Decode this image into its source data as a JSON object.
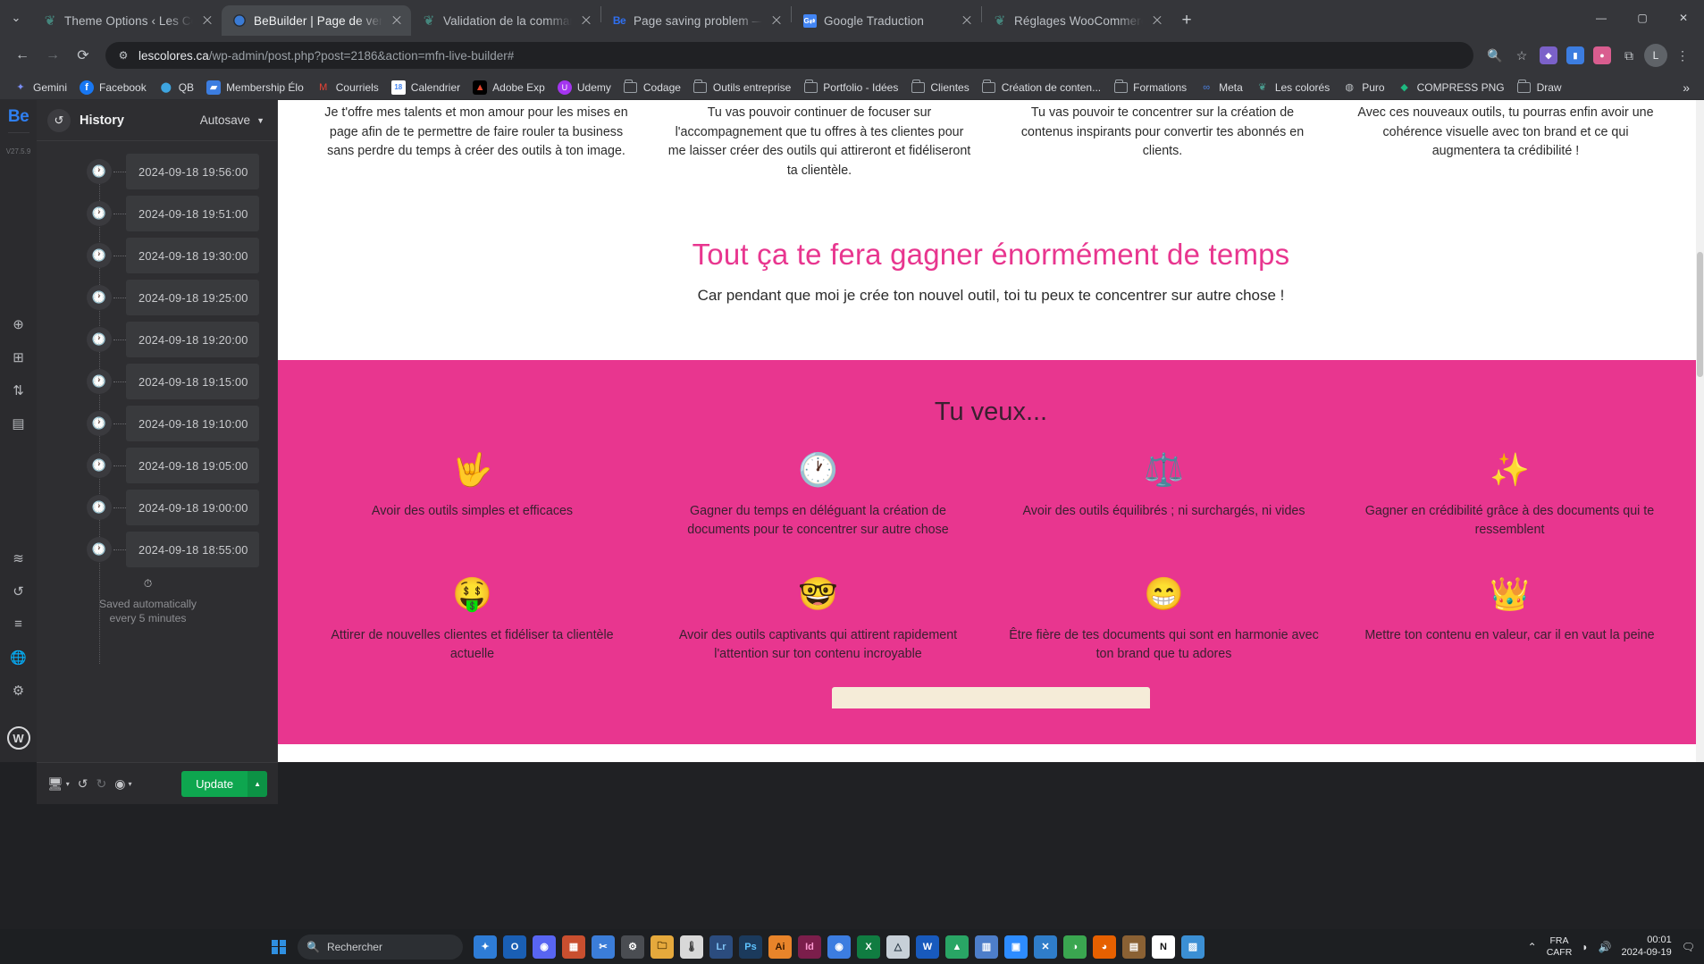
{
  "browser": {
    "tabs": [
      {
        "title": "Theme Options ‹ Les Colorés —",
        "favicon": "wordpress-icon",
        "active": false
      },
      {
        "title": "BeBuilder | Page de vente – Out",
        "favicon": "globe-icon",
        "active": true
      },
      {
        "title": "Validation de la commande - Le",
        "favicon": "wordpress-icon",
        "active": false
      },
      {
        "title": "Page saving problem — Bethem",
        "favicon": "bebuilder-icon",
        "active": false
      },
      {
        "title": "Google Traduction",
        "favicon": "google-translate-icon",
        "active": false
      },
      {
        "title": "Réglages WooCommerce ‹ Les C",
        "favicon": "wordpress-icon",
        "active": false
      }
    ],
    "new_tab_label": "+",
    "tab_search_label": "⌄",
    "window_controls": {
      "minimize": "—",
      "maximize": "▢",
      "close": "✕"
    },
    "nav": {
      "back": "←",
      "forward": "→",
      "reload": "⟳"
    },
    "url": {
      "host": "lescolores.ca",
      "path": "/wp-admin/post.php?post=2186&action=mfn-live-builder#",
      "site_info_icon": "page-info-icon"
    },
    "omnibox_actions": [
      {
        "name": "search-icon",
        "glyph": "🔍"
      },
      {
        "name": "bookmark-star-icon",
        "glyph": "☆"
      }
    ],
    "extensions": [
      {
        "name": "extension-puzzle-icon",
        "glyph": "🧩",
        "color": "#7b61c9"
      },
      {
        "name": "extension-bar-icon",
        "glyph": "▮▮",
        "color": "#3c7de0"
      },
      {
        "name": "extension-circle-icon",
        "glyph": "◕",
        "color": "#d95d8f"
      },
      {
        "name": "extensions-menu-icon",
        "glyph": "⧉",
        "color": "#5f6368"
      }
    ],
    "profile_initial": "L",
    "chrome_menu_icon": "⋮",
    "bookmarks": [
      {
        "label": "Gemini",
        "icon": "gemini-icon",
        "type": "site"
      },
      {
        "label": "Facebook",
        "icon": "facebook-icon",
        "type": "site"
      },
      {
        "label": "QB",
        "icon": "quickbooks-icon",
        "type": "site"
      },
      {
        "label": "Membership Élo",
        "icon": "membership-icon",
        "type": "site"
      },
      {
        "label": "Courriels",
        "icon": "gmail-icon",
        "type": "site"
      },
      {
        "label": "Calendrier",
        "icon": "google-calendar-icon",
        "type": "site"
      },
      {
        "label": "Adobe Exp",
        "icon": "adobe-icon",
        "type": "site"
      },
      {
        "label": "Udemy",
        "icon": "udemy-icon",
        "type": "site"
      },
      {
        "label": "Codage",
        "icon": "folder-icon",
        "type": "folder"
      },
      {
        "label": "Outils entreprise",
        "icon": "folder-icon",
        "type": "folder"
      },
      {
        "label": "Portfolio - Idées",
        "icon": "folder-icon",
        "type": "folder"
      },
      {
        "label": "Clientes",
        "icon": "folder-icon",
        "type": "folder"
      },
      {
        "label": "Création de conten...",
        "icon": "folder-icon",
        "type": "folder"
      },
      {
        "label": "Formations",
        "icon": "folder-icon",
        "type": "folder"
      },
      {
        "label": "Meta",
        "icon": "meta-icon",
        "type": "site"
      },
      {
        "label": "Les colorés",
        "icon": "wordpress-icon",
        "type": "site"
      },
      {
        "label": "Puro",
        "icon": "puro-icon",
        "type": "site"
      },
      {
        "label": "COMPRESS PNG",
        "icon": "compress-png-icon",
        "type": "site"
      },
      {
        "label": "Draw",
        "icon": "folder-icon",
        "type": "folder"
      }
    ],
    "bookmarks_overflow": "»"
  },
  "builder": {
    "logo": "Be",
    "version": "V27.5.9",
    "rail_icons": [
      {
        "name": "add-section-icon",
        "glyph": "⊕"
      },
      {
        "name": "grid-layout-icon",
        "glyph": "⊞"
      },
      {
        "name": "reorder-icon",
        "glyph": "⇅"
      },
      {
        "name": "wireframe-icon",
        "glyph": "▤"
      },
      {
        "name": "layers-icon",
        "glyph": "≋"
      },
      {
        "name": "history-icon",
        "glyph": "↺"
      },
      {
        "name": "settings-sliders-icon",
        "glyph": "≡"
      },
      {
        "name": "globe-icon",
        "glyph": "🌐"
      },
      {
        "name": "gear-icon",
        "glyph": "⚙"
      }
    ],
    "wordpress_icon": "W",
    "history_panel": {
      "icon": "history-clock-icon",
      "title": "History",
      "filter_label": "Autosave",
      "filter_chevron": "▼",
      "entries": [
        {
          "timestamp": "2024-09-18 19:56:00",
          "icon": "clock-icon"
        },
        {
          "timestamp": "2024-09-18 19:51:00",
          "icon": "clock-icon"
        },
        {
          "timestamp": "2024-09-18 19:30:00",
          "icon": "clock-icon"
        },
        {
          "timestamp": "2024-09-18 19:25:00",
          "icon": "clock-icon"
        },
        {
          "timestamp": "2024-09-18 19:20:00",
          "icon": "clock-icon"
        },
        {
          "timestamp": "2024-09-18 19:15:00",
          "icon": "clock-icon"
        },
        {
          "timestamp": "2024-09-18 19:10:00",
          "icon": "clock-icon"
        },
        {
          "timestamp": "2024-09-18 19:05:00",
          "icon": "clock-icon"
        },
        {
          "timestamp": "2024-09-18 19:00:00",
          "icon": "clock-icon"
        },
        {
          "timestamp": "2024-09-18 18:55:00",
          "icon": "clock-icon"
        }
      ],
      "footer_icon": "info-icon",
      "footer_line1": "Saved automatically",
      "footer_line2": "every 5 minutes"
    },
    "collapse_handle": "‹",
    "bottom_toolbar": {
      "responsive_icon": "🖥",
      "responsive_chevron": "▾",
      "undo_icon": "↺",
      "redo_icon": "↻",
      "preview_icon": "◉",
      "preview_chevron": "▾",
      "update_label": "Update",
      "update_arrow": "▲",
      "update_color": "#0ea64f"
    }
  },
  "page": {
    "top_columns": [
      "Je t'offre mes talents et mon amour pour les mises en page afin de te permettre de faire rouler ta business sans perdre du temps à créer des outils à ton image.",
      "Tu vas pouvoir continuer de focuser sur l'accompagnement que tu offres à tes clientes pour me laisser créer des outils qui attireront et fidéliseront ta clientèle.",
      "Tu vas pouvoir te concentrer sur la création de contenus inspirants pour convertir tes abonnés en clients.",
      "Avec ces nouveaux outils, tu pourras enfin avoir une cohérence visuelle avec ton brand et ce qui augmentera ta crédibilité !"
    ],
    "heading": "Tout ça te fera gagner énormément de temps",
    "heading_color": "#e8368f",
    "subheading": "Car pendant que moi je crée ton nouvel outil, toi tu peux te concentrer sur autre chose !",
    "pink_section": {
      "background_color": "#e8368f",
      "title": "Tu veux...",
      "cells": [
        {
          "emoji": "🤟",
          "icon_name": "hand-horns-emoji",
          "text": "Avoir des outils simples et efficaces"
        },
        {
          "emoji": "🕐",
          "icon_name": "clock-emoji",
          "text": "Gagner du temps en déléguant la création de documents pour te concentrer sur autre chose"
        },
        {
          "emoji": "⚖️",
          "icon_name": "balance-scale-emoji",
          "text": "Avoir des outils équilibrés ; ni surchargés, ni vides"
        },
        {
          "emoji": "✨",
          "icon_name": "sparkles-emoji",
          "text": "Gagner en crédibilité grâce à des documents qui te ressemblent"
        },
        {
          "emoji": "🤑",
          "icon_name": "money-face-emoji",
          "text": "Attirer de nouvelles clientes et fidéliser ta clientèle actuelle"
        },
        {
          "emoji": "🤓",
          "icon_name": "nerd-face-emoji",
          "text": "Avoir des outils captivants qui attirent rapidement l'attention sur ton contenu incroyable"
        },
        {
          "emoji": "😁",
          "icon_name": "grinning-face-emoji",
          "text": "Être fière de tes documents qui sont en harmonie avec ton brand que tu adores"
        },
        {
          "emoji": "👑",
          "icon_name": "crown-emoji",
          "text": "Mettre ton contenu en valeur, car il en vaut la peine"
        }
      ]
    }
  },
  "taskbar": {
    "start_icon": "windows-start-icon",
    "search_placeholder": "Rechercher",
    "search_icon": "search-icon",
    "pinned_apps": [
      {
        "name": "copilot-icon",
        "glyph": "✦",
        "color": "#2e7cd6"
      },
      {
        "name": "outlook-icon",
        "glyph": "O",
        "color": "#1a5fb4"
      },
      {
        "name": "discord-icon",
        "glyph": "◉",
        "color": "#5865f2"
      },
      {
        "name": "excel-sheets-icon",
        "glyph": "▦",
        "color": "#c94f2f"
      },
      {
        "name": "vscode-alt-icon",
        "glyph": "✂",
        "color": "#3b7dd8"
      },
      {
        "name": "settings-icon",
        "glyph": "⚙",
        "color": "#4a4d52"
      },
      {
        "name": "file-explorer-icon",
        "glyph": "🗀",
        "color": "#e5a93c"
      },
      {
        "name": "thermometer-icon",
        "glyph": "🌡",
        "color": "#d8d8d8"
      },
      {
        "name": "lightroom-icon",
        "glyph": "Lr",
        "color": "#2b4c7e"
      },
      {
        "name": "photoshop-icon",
        "glyph": "Ps",
        "color": "#1b3a5c"
      },
      {
        "name": "illustrator-icon",
        "glyph": "Ai",
        "color": "#e8842a"
      },
      {
        "name": "indesign-icon",
        "glyph": "Id",
        "color": "#7b1e4b"
      },
      {
        "name": "chrome-icon",
        "glyph": "◉",
        "color": "#3c7de0"
      },
      {
        "name": "excel-icon",
        "glyph": "X",
        "color": "#107c41"
      },
      {
        "name": "affinity-icon",
        "glyph": "△",
        "color": "#c7d0d8"
      },
      {
        "name": "word-icon",
        "glyph": "W",
        "color": "#185abd"
      },
      {
        "name": "drive-icon",
        "glyph": "▲",
        "color": "#29a565"
      },
      {
        "name": "stats-icon",
        "glyph": "▥",
        "color": "#4d7ec9"
      },
      {
        "name": "zoom-icon",
        "glyph": "▣",
        "color": "#2d8cff"
      },
      {
        "name": "vscode-icon",
        "glyph": "✕",
        "color": "#2f7dc9"
      },
      {
        "name": "filezilla-icon",
        "glyph": "◑",
        "color": "#3aa650"
      },
      {
        "name": "firefox-icon",
        "glyph": "◕",
        "color": "#e66000"
      },
      {
        "name": "lightburn-icon",
        "glyph": "▤",
        "color": "#8a6134"
      },
      {
        "name": "notion-icon",
        "glyph": "N",
        "color": "#ffffff"
      },
      {
        "name": "photos-icon",
        "glyph": "▨",
        "color": "#3b8fd4"
      }
    ],
    "tray": {
      "overflow_icon": "⌃",
      "language_line1": "FRA",
      "language_line2": "CAFR",
      "network_icon": "◗",
      "volume_icon": "🔊",
      "time": "00:01",
      "date": "2024-09-19",
      "notification_icon": "🗨"
    }
  }
}
